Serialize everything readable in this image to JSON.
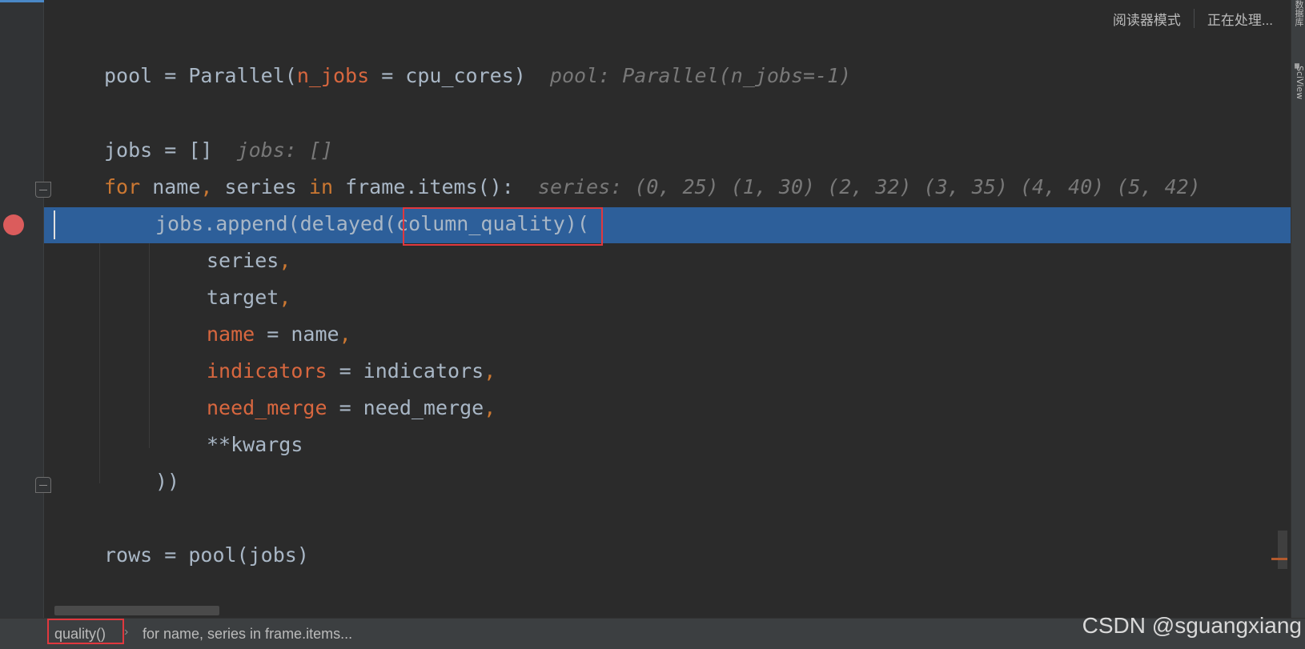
{
  "reader_bar": {
    "reader_mode": "阅读器模式",
    "processing": "正在处理..."
  },
  "right_strip": {
    "database": "数据库",
    "sciview": "SciView"
  },
  "code": {
    "l1": {
      "a": "pool = Parallel(",
      "p": "n_jobs",
      "b": " = cpu_cores)",
      "hint": "pool: Parallel(n_jobs=-1)"
    },
    "l2": {
      "a": "jobs = []",
      "hint": "jobs: []"
    },
    "l3": {
      "for": "for",
      "a": " name",
      "comma": ",",
      "b": " series ",
      "in": "in",
      "c": " frame.items():",
      "hint": "series: (0, 25) (1, 30) (2, 32) (3, 35) (4, 40) (5, 42)"
    },
    "l4": {
      "a": "jobs.append(delayed",
      "b": "(column_quality)",
      "c": "("
    },
    "l5": {
      "a": "series",
      "comma": ","
    },
    "l6": {
      "a": "target",
      "comma": ","
    },
    "l7": {
      "p": "name",
      "a": " = name",
      "comma": ","
    },
    "l8": {
      "p": "indicators",
      "a": " = indicators",
      "comma": ","
    },
    "l9": {
      "p": "need_merge",
      "a": " = need_merge",
      "comma": ","
    },
    "l10": {
      "a": "**kwargs"
    },
    "l11": {
      "a": "))"
    },
    "l12": {
      "a": "rows = pool(jobs)"
    }
  },
  "status": {
    "crumb1": "quality()",
    "crumb_sep": "›",
    "crumb2": "for name, series in frame.items..."
  },
  "watermark": "CSDN @sguangxiang",
  "colors": {
    "highlight_row": "#2d5f9a",
    "keyword": "#cc7832",
    "param": "#d8673f",
    "breakpoint": "#db5c5c",
    "annotation_box": "#e0383e"
  }
}
